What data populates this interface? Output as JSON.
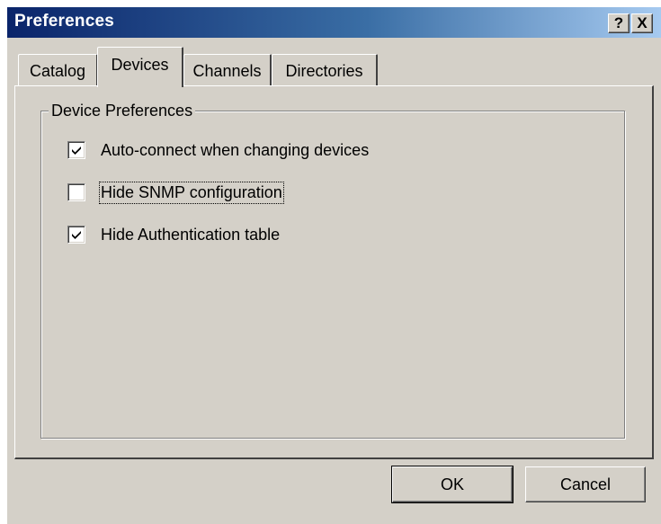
{
  "window": {
    "title": "Preferences"
  },
  "titlebar_buttons": {
    "help": "?",
    "close": "X"
  },
  "tabs": [
    {
      "label": "Catalog",
      "active": false
    },
    {
      "label": "Devices",
      "active": true
    },
    {
      "label": "Channels",
      "active": false
    },
    {
      "label": "Directories",
      "active": false
    }
  ],
  "group": {
    "label": "Device Preferences"
  },
  "options": [
    {
      "label": "Auto-connect when changing devices",
      "checked": true
    },
    {
      "label": "Hide SNMP configuration",
      "checked": false,
      "focused": true
    },
    {
      "label": "Hide Authentication table",
      "checked": true
    }
  ],
  "buttons": {
    "ok": "OK",
    "cancel": "Cancel"
  },
  "colors": {
    "titlebar_start": "#0a246a",
    "titlebar_end": "#a6caf0",
    "face": "#d4d0c8"
  }
}
